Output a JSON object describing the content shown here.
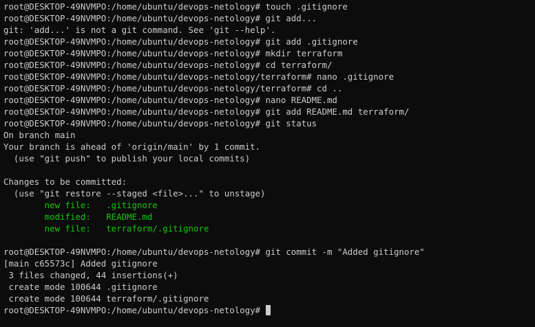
{
  "terminal": {
    "lines": [
      {
        "text": "root@DESKTOP-49NVMPO:/home/ubuntu/devops-netology# touch .gitignore",
        "style": "default"
      },
      {
        "text": "root@DESKTOP-49NVMPO:/home/ubuntu/devops-netology# git add...",
        "style": "default"
      },
      {
        "text": "git: 'add...' is not a git command. See 'git --help'.",
        "style": "default"
      },
      {
        "text": "root@DESKTOP-49NVMPO:/home/ubuntu/devops-netology# git add .gitignore",
        "style": "default"
      },
      {
        "text": "root@DESKTOP-49NVMPO:/home/ubuntu/devops-netology# mkdir terraform",
        "style": "default"
      },
      {
        "text": "root@DESKTOP-49NVMPO:/home/ubuntu/devops-netology# cd terraform/",
        "style": "default"
      },
      {
        "text": "root@DESKTOP-49NVMPO:/home/ubuntu/devops-netology/terraform# nano .gitignore",
        "style": "default"
      },
      {
        "text": "root@DESKTOP-49NVMPO:/home/ubuntu/devops-netology/terraform# cd ..",
        "style": "default"
      },
      {
        "text": "root@DESKTOP-49NVMPO:/home/ubuntu/devops-netology# nano README.md",
        "style": "default"
      },
      {
        "text": "root@DESKTOP-49NVMPO:/home/ubuntu/devops-netology# git add README.md terraform/",
        "style": "default"
      },
      {
        "text": "root@DESKTOP-49NVMPO:/home/ubuntu/devops-netology# git status",
        "style": "default"
      },
      {
        "text": "On branch main",
        "style": "default"
      },
      {
        "text": "Your branch is ahead of 'origin/main' by 1 commit.",
        "style": "default"
      },
      {
        "text": "  (use \"git push\" to publish your local commits)",
        "style": "default"
      },
      {
        "text": "",
        "style": "default"
      },
      {
        "text": "Changes to be committed:",
        "style": "default"
      },
      {
        "text": "  (use \"git restore --staged <file>...\" to unstage)",
        "style": "default"
      },
      {
        "text": "        new file:   .gitignore",
        "style": "green"
      },
      {
        "text": "        modified:   README.md",
        "style": "green"
      },
      {
        "text": "        new file:   terraform/.gitignore",
        "style": "green"
      },
      {
        "text": "",
        "style": "default"
      },
      {
        "text": "root@DESKTOP-49NVMPO:/home/ubuntu/devops-netology# git commit -m \"Added gitignore\"",
        "style": "default"
      },
      {
        "text": "[main c65573c] Added gitignore",
        "style": "default"
      },
      {
        "text": " 3 files changed, 44 insertions(+)",
        "style": "default"
      },
      {
        "text": " create mode 100644 .gitignore",
        "style": "default"
      },
      {
        "text": " create mode 100644 terraform/.gitignore",
        "style": "default"
      }
    ],
    "prompt": "root@DESKTOP-49NVMPO:/home/ubuntu/devops-netology# ",
    "colors": {
      "background": "#0c0c0c",
      "foreground": "#cccccc",
      "staged_file": "#16c60c"
    }
  }
}
